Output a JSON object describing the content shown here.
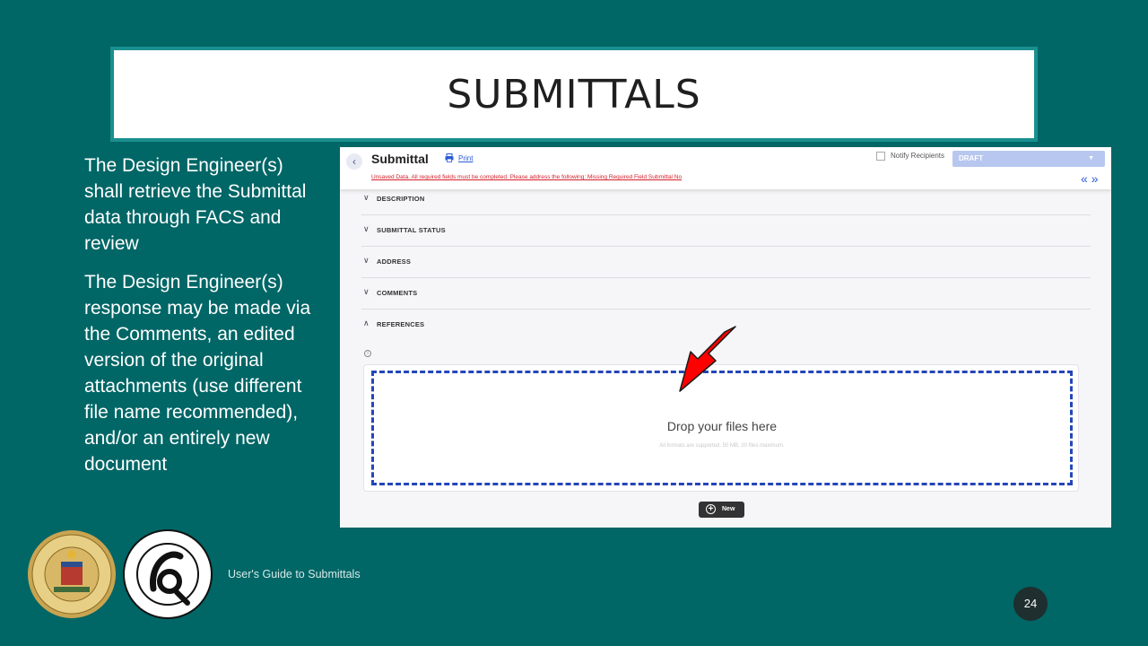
{
  "slide": {
    "title": "SUBMITTALS",
    "paragraphs": [
      "The Design Engineer(s) shall retrieve the Submittal data through FACS and review",
      "The Design Engineer(s) response may be made via the Comments, an edited version of the original attachments (use different file name recommended), and/or an entirely new document"
    ],
    "footer_text": "User's Guide to Submittals",
    "page_number": "24"
  },
  "app": {
    "back_icon": "chevron-left-icon",
    "title": "Submittal",
    "print_label": "Print",
    "notify_label": "Notify Recipients",
    "notify_checked": false,
    "status_value": "DRAFT",
    "unsaved_message": "Unsaved Data. All required fields must be completed. Please address the following: Missing Required Field Submittal No",
    "collapse_arrows": "«»",
    "sections": [
      {
        "label": "DESCRIPTION",
        "expanded": false
      },
      {
        "label": "SUBMITTAL STATUS",
        "expanded": false
      },
      {
        "label": "ADDRESS",
        "expanded": false
      },
      {
        "label": "COMMENTS",
        "expanded": false
      },
      {
        "label": "REFERENCES",
        "expanded": true
      }
    ],
    "dropzone": {
      "title": "Drop your files here",
      "subtitle": "All formats are supported. 50 MB, 20 files maximum."
    },
    "new_button_label": "New"
  },
  "colors": {
    "background": "#006666",
    "title_border": "#1a8f8f",
    "accent_blue": "#2a5bd7",
    "dashed_border": "#2446b8",
    "status_bg": "#b7c7ef",
    "error_red": "#d4202a",
    "arrow_red": "#ff0000"
  }
}
